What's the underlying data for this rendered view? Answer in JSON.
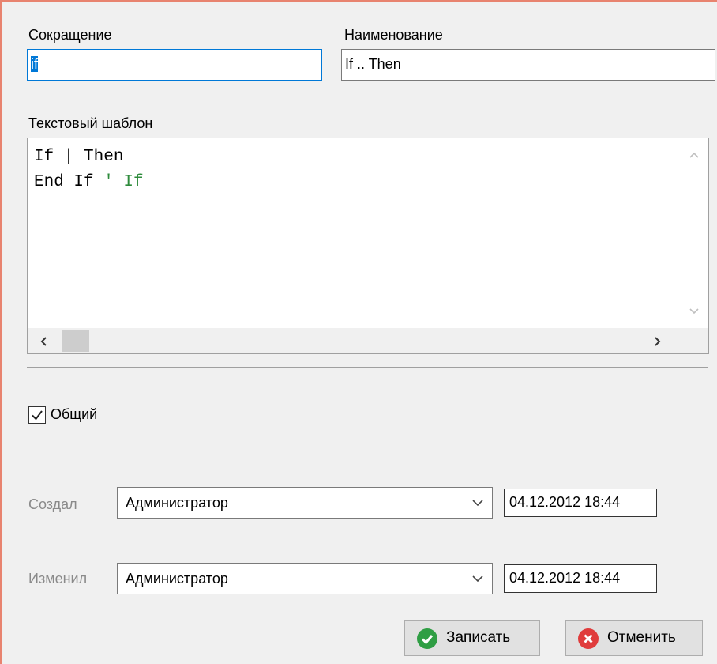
{
  "form": {
    "abbr_label": "Сокращение",
    "abbr_value": "if",
    "name_label": "Наименование",
    "name_value": "If .. Then",
    "template_label": "Текстовый шаблон",
    "template_lines": {
      "line1": "If | Then",
      "line2": "",
      "line3_code": "End If ",
      "line3_comment": "' If"
    },
    "common_label": "Общий",
    "common_checked": true,
    "created_label": "Создал",
    "created_by": "Администратор",
    "created_at": "04.12.2012 18:44",
    "modified_label": "Изменил",
    "modified_by": "Администратор",
    "modified_at": "04.12.2012 18:44"
  },
  "buttons": {
    "save_label": "Записать",
    "cancel_label": "Отменить"
  },
  "colors": {
    "accent": "#0078d7",
    "comment": "#2e8b3c",
    "save_icon": "#2f9e44",
    "cancel_icon": "#e03c3c",
    "window_border": "#e8836f"
  },
  "icons": {
    "save": "check-circle-icon",
    "cancel": "x-circle-icon",
    "dropdown": "chevron-down-icon"
  }
}
